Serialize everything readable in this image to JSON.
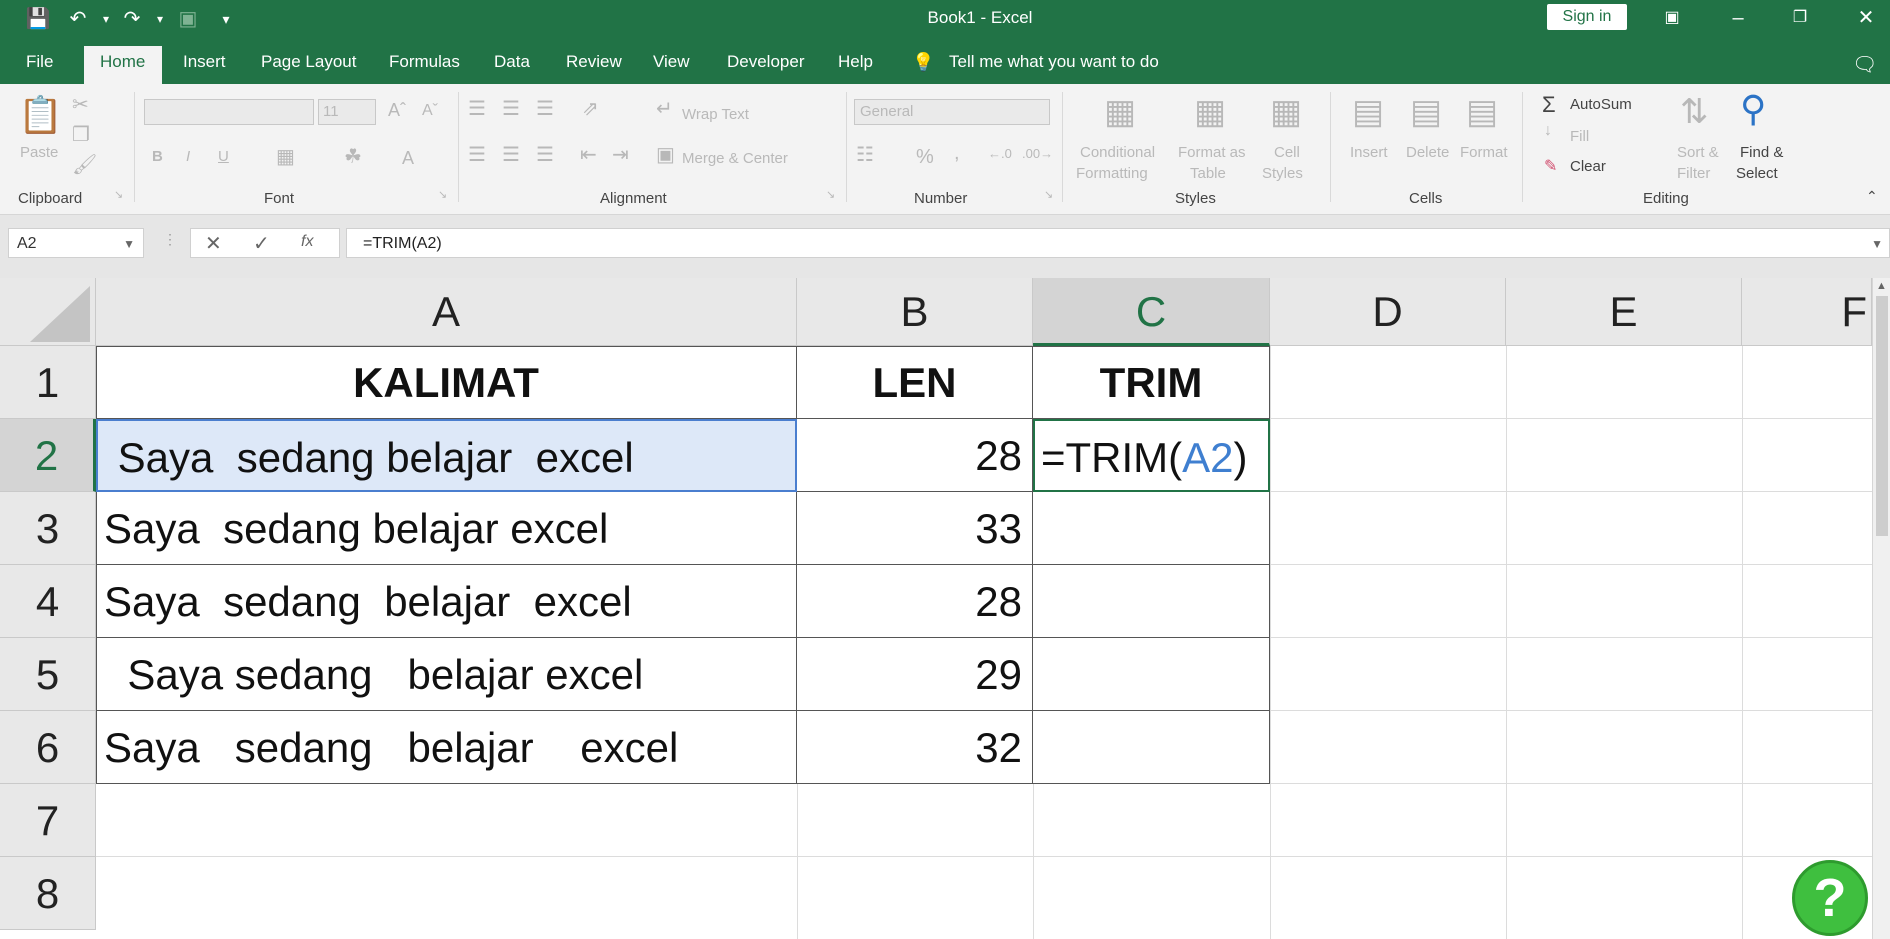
{
  "app": {
    "title": "Book1  -  Excel",
    "sign_in": "Sign in"
  },
  "tabs": [
    "File",
    "Home",
    "Insert",
    "Page Layout",
    "Formulas",
    "Data",
    "Review",
    "View",
    "Developer",
    "Help"
  ],
  "tell_me": "Tell me what you want to do",
  "ribbon": {
    "clipboard": {
      "paste": "Paste",
      "label": "Clipboard"
    },
    "font": {
      "size": "11",
      "label": "Font",
      "bold": "B",
      "italic": "I",
      "underline": "U"
    },
    "alignment": {
      "wrap": "Wrap Text",
      "merge": "Merge & Center",
      "label": "Alignment"
    },
    "number": {
      "format": "General",
      "percent": "%",
      "comma": ",",
      "label": "Number"
    },
    "styles": {
      "cond1": "Conditional",
      "cond2": "Formatting",
      "fmt1": "Format as",
      "fmt2": "Table",
      "cell1": "Cell",
      "cell2": "Styles",
      "label": "Styles"
    },
    "cells": {
      "insert": "Insert",
      "delete": "Delete",
      "format": "Format",
      "label": "Cells"
    },
    "editing": {
      "autosum": "AutoSum",
      "fill": "Fill",
      "clear": "Clear",
      "sort1": "Sort &",
      "sort2": "Filter",
      "find1": "Find &",
      "find2": "Select",
      "label": "Editing"
    }
  },
  "formula_bar": {
    "name_box": "A2",
    "formula": "=TRIM(A2)",
    "fx": "fx"
  },
  "columns": [
    "A",
    "B",
    "C",
    "D",
    "E",
    "F"
  ],
  "rows": [
    "1",
    "2",
    "3",
    "4",
    "5",
    "6",
    "7",
    "8"
  ],
  "table": {
    "header": {
      "a": "KALIMAT",
      "b": "LEN",
      "c": "TRIM"
    },
    "data": [
      {
        "a": " Saya  sedang belajar  excel",
        "b": "28"
      },
      {
        "a": "Saya  sedang belajar excel",
        "b": "33"
      },
      {
        "a": "Saya  sedang  belajar  excel",
        "b": "28"
      },
      {
        "a": "  Saya sedang   belajar excel",
        "b": "29"
      },
      {
        "a": "Saya   sedang   belajar    excel",
        "b": "32"
      }
    ],
    "editing_cell": {
      "prefix": "=TRIM(",
      "ref": "A2",
      "suffix": ")"
    }
  },
  "colors": {
    "excel_green": "#217346",
    "ref_blue": "#3f7fd0",
    "selection": "#dde8f8"
  },
  "help_badge": "?"
}
